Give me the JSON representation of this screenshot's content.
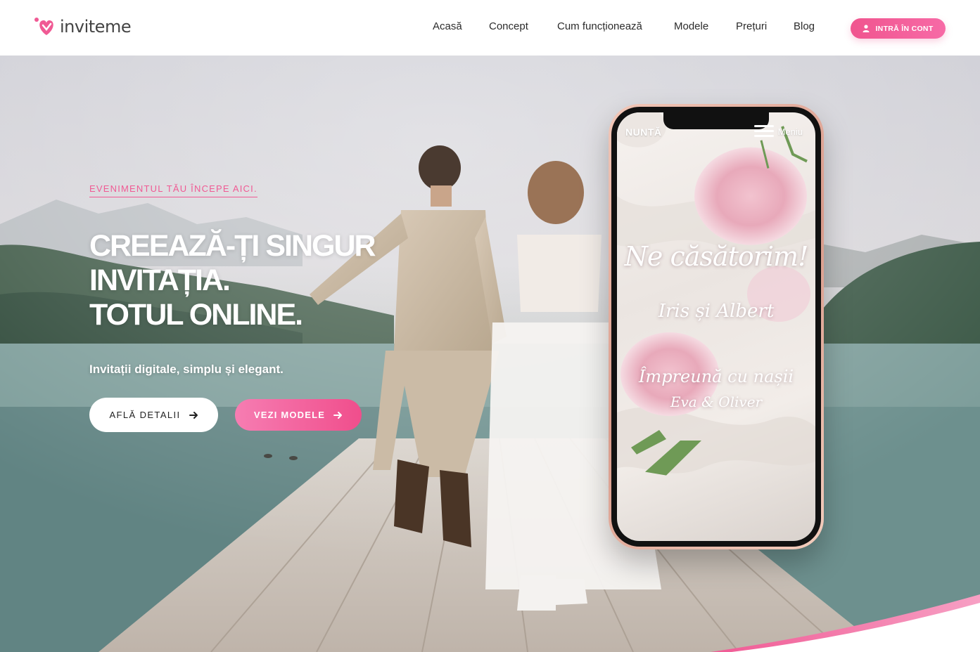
{
  "brand": {
    "name_prefix": "invite",
    "name_suffix": "me"
  },
  "nav": {
    "items": [
      "Acasă",
      "Concept",
      "Cum funcționează",
      "Modele",
      "Prețuri",
      "Blog"
    ],
    "login_label": "INTRĂ ÎN CONT"
  },
  "hero": {
    "eyebrow": "EVENIMENTUL TĂU ÎNCEPE AICI.",
    "headline": [
      "CREEAZĂ-ȚI SINGUR",
      "INVITAȚIA.",
      "TOTUL ONLINE."
    ],
    "subtitle": "Invitații digitale, simplu și elegant.",
    "btn_details": "AFLĂ DETALII",
    "btn_models": "VEZI MODELE"
  },
  "phone": {
    "top_label": "NUNTĂ",
    "menu_label": "Meniu",
    "line1": "Ne căsătorim!",
    "line2": "Iris și Albert",
    "line3": "Împreună cu nașii",
    "line4": "Eva & Oliver"
  },
  "colors": {
    "accent": "#f05a94",
    "accent_light": "#f67db2",
    "nav_text": "#2b2b2b"
  },
  "icons": {
    "login": "user-icon",
    "arrow": "arrow-right-icon",
    "menu": "hamburger-icon",
    "logo": "heart-logo-icon"
  }
}
